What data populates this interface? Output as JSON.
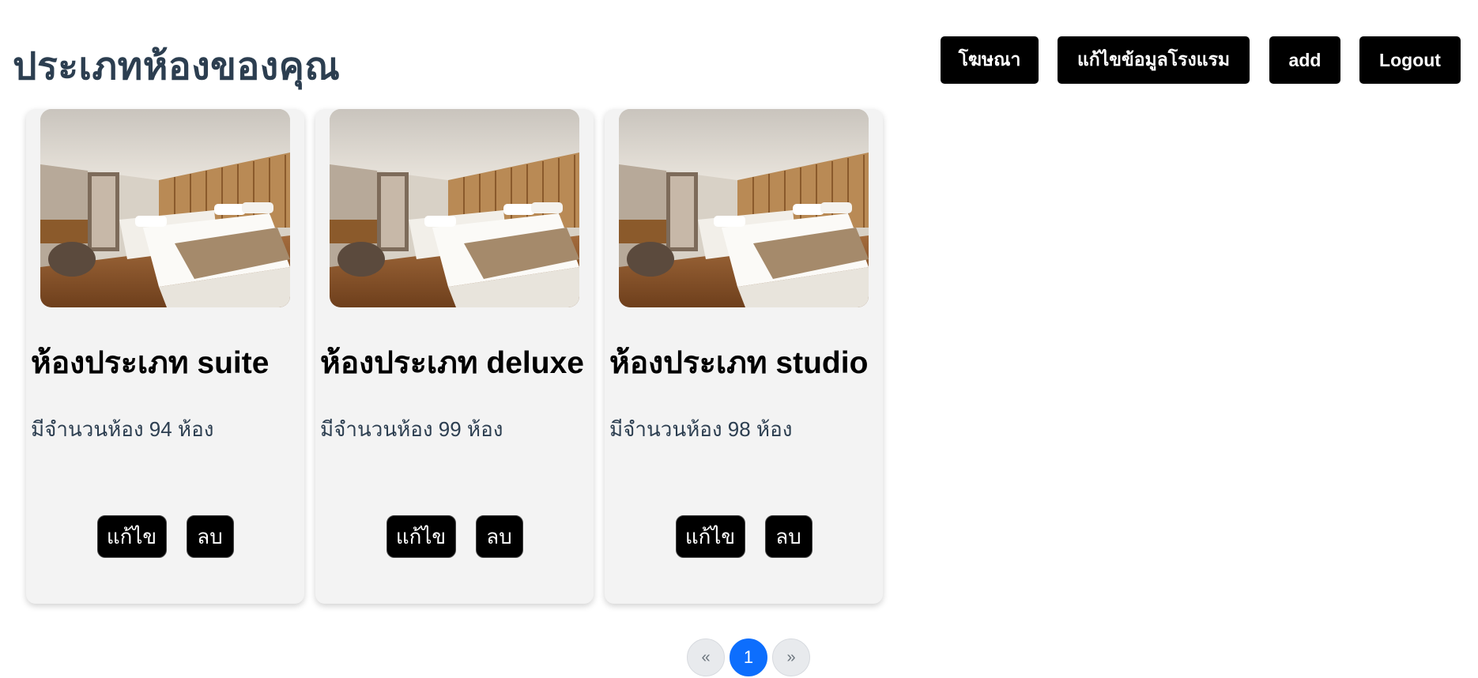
{
  "header": {
    "title": "ประเภทห้องของคุณ",
    "buttons": {
      "ads": "โฆษณา",
      "edit_hotel": "แก้ไขข้อมูลโรงแรม",
      "add": "add",
      "logout": "Logout"
    }
  },
  "room_types": [
    {
      "title": "ห้องประเภท suite",
      "count_text": "มีจำนวนห้อง 94 ห้อง",
      "edit_label": "แก้ไข",
      "delete_label": "ลบ",
      "image": "hotel-room-photo"
    },
    {
      "title": "ห้องประเภท deluxe",
      "count_text": "มีจำนวนห้อง 99 ห้อง",
      "edit_label": "แก้ไข",
      "delete_label": "ลบ",
      "image": "hotel-room-photo"
    },
    {
      "title": "ห้องประเภท studio",
      "count_text": "มีจำนวนห้อง 98 ห้อง",
      "edit_label": "แก้ไข",
      "delete_label": "ลบ",
      "image": "hotel-room-photo"
    }
  ],
  "pagination": {
    "prev": "«",
    "current": "1",
    "next": "»"
  },
  "colors": {
    "title": "#2c3e50",
    "button_bg": "#000000",
    "button_text": "#ffffff",
    "card_bg": "#f3f3f3",
    "pagination_active": "#0d6efd"
  }
}
